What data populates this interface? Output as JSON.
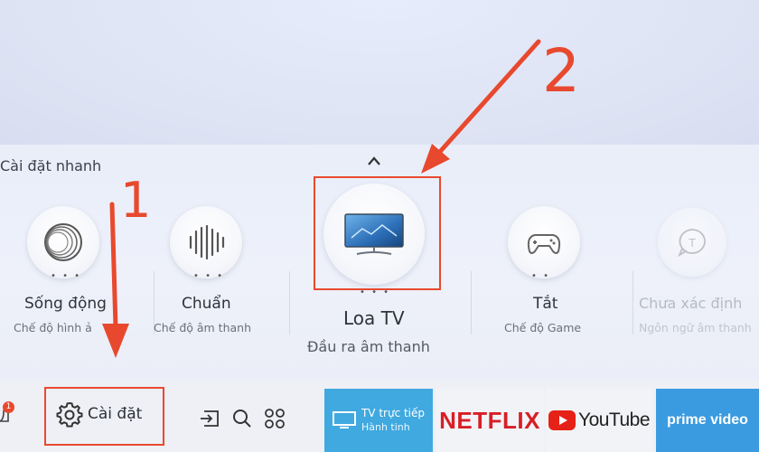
{
  "quick_settings": {
    "title": "Cài đặt nhanh",
    "items": [
      {
        "label": "Sống động",
        "sub": "Chế độ hình ả"
      },
      {
        "label": "Chuẩn",
        "sub": "Chế độ âm thanh"
      },
      {
        "label": "Loa TV",
        "sub": "Đầu ra âm thanh"
      },
      {
        "label": "Tắt",
        "sub": "Chế độ Game"
      },
      {
        "label": "Chưa xác định",
        "sub": "Ngôn ngữ âm thanh"
      }
    ]
  },
  "bottom_bar": {
    "notification_count": "1",
    "settings_label": "Cài đặt",
    "apps": {
      "live_tv_line1": "TV trực tiếp",
      "live_tv_line2": "Hành tinh",
      "netflix": "NETFLIX",
      "youtube": "YouTube",
      "prime": "prime video"
    }
  },
  "annotations": {
    "one": "1",
    "two": "2"
  },
  "colors": {
    "accent_red": "#e8492e",
    "live_tv_blue": "#3fa9e0",
    "prime_blue": "#3b9be0",
    "netflix_red": "#d81f26"
  }
}
